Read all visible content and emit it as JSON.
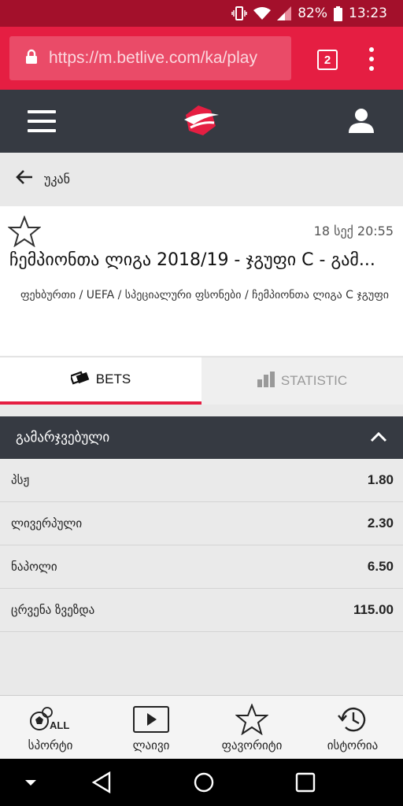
{
  "status_bar": {
    "battery": "82%",
    "time": "13:23"
  },
  "browser": {
    "url": "https://m.betlive.com/ka/play",
    "tab_count": "2"
  },
  "back": {
    "label": "უკან"
  },
  "event": {
    "date": "18 სექ 20:55",
    "title": "ჩემპიონთა ლიგა 2018/19 - ჯგუფი C - გამ...",
    "path": "ფეხბურთი / UEFA / სპეციალური ფსონები / ჩემპიონთა ლიგა C ჯგუფი"
  },
  "tabs": {
    "bets": "BETS",
    "statistic": "STATISTIC"
  },
  "market": {
    "title": "გამარჯვებული",
    "rows": [
      {
        "name": "პსჟ",
        "odds": "1.80"
      },
      {
        "name": "ლივერპული",
        "odds": "2.30"
      },
      {
        "name": "ნაპოლი",
        "odds": "6.50"
      },
      {
        "name": "ცრვენა ზვეზდა",
        "odds": "115.00"
      }
    ]
  },
  "bottom_nav": {
    "sports": "სპორტი",
    "sports_badge": "ALL",
    "live": "ლაივი",
    "favorites": "ფავორიტი",
    "history": "ისტორია"
  },
  "colors": {
    "brand_red": "#e51e42",
    "status_red": "#a3102b",
    "header_dark": "#363a42"
  }
}
